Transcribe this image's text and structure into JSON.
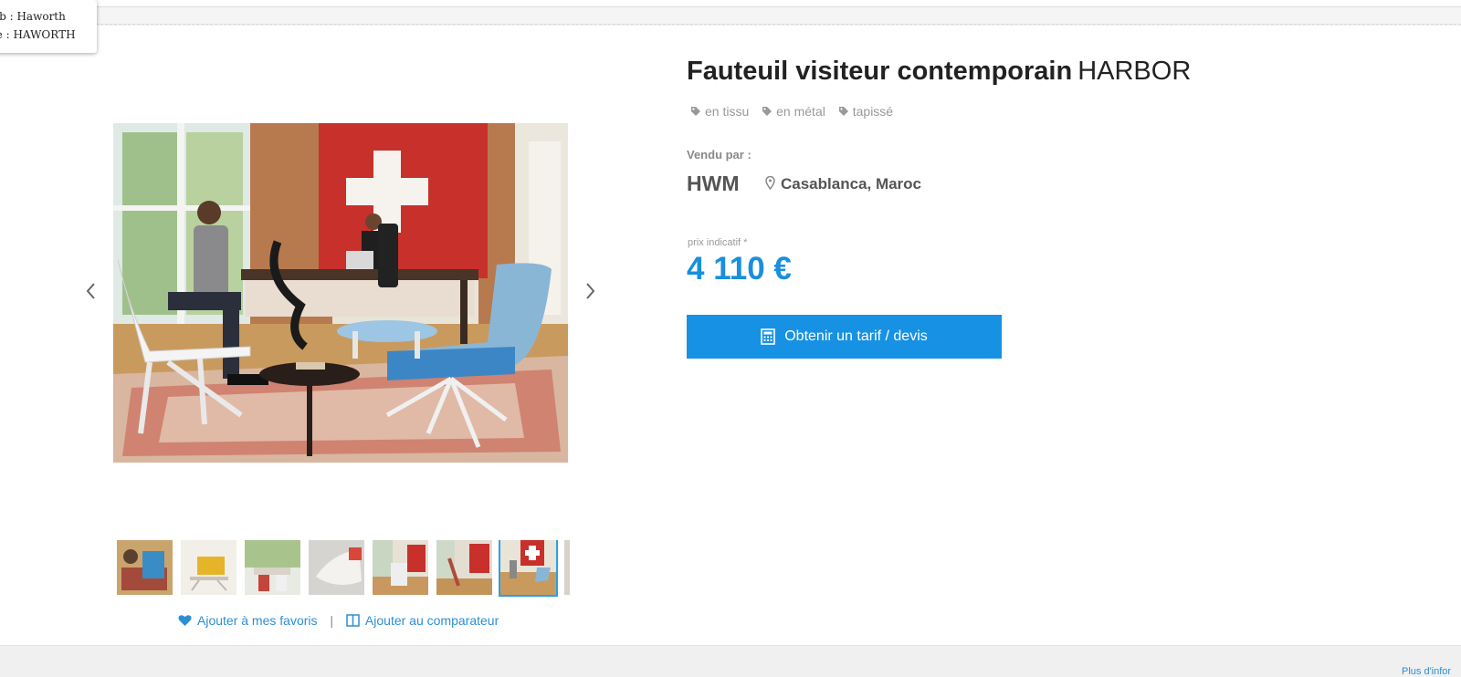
{
  "tooltip": {
    "line1": "eb : Haworth",
    "line2": "pe : HAWORTH"
  },
  "product": {
    "title_main": "Fauteuil visiteur contemporain",
    "title_brand": "HARBOR",
    "tags": [
      "en tissu",
      "en métal",
      "tapissé"
    ]
  },
  "seller": {
    "label": "Vendu par :",
    "name": "HWM",
    "location": "Casablanca, Maroc"
  },
  "price": {
    "label": "prix indicatif *",
    "value": "4 110 €"
  },
  "cta": {
    "label": "Obtenir un tarif / devis"
  },
  "gallery": {
    "prev_icon": "chevron-left-icon",
    "next_icon": "chevron-right-icon",
    "thumb_count": 7,
    "active_thumb": 7
  },
  "actions": {
    "favorite": "Ajouter à mes favoris",
    "separator": "|",
    "compare": "Ajouter au comparateur"
  },
  "footer": {
    "more_info": "Plus d'infor"
  },
  "colors": {
    "accent": "#1791e3",
    "price": "#1a8fdc",
    "link": "#2b8fd4"
  }
}
